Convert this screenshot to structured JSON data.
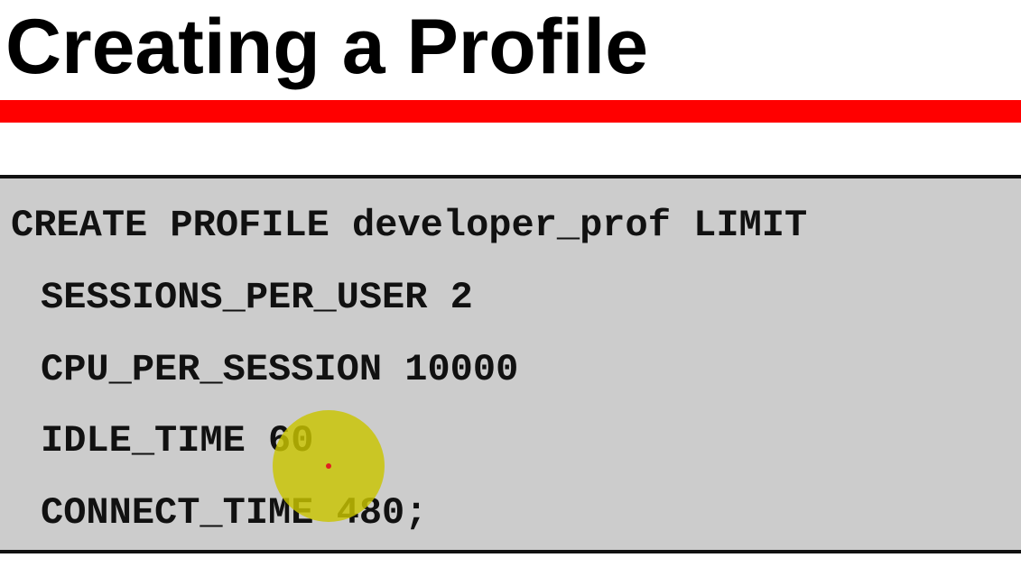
{
  "slide": {
    "title": "Creating a Profile"
  },
  "code": {
    "lines": [
      "CREATE PROFILE developer_prof LIMIT",
      "SESSIONS_PER_USER 2",
      "CPU_PER_SESSION 10000",
      "IDLE_TIME 60",
      "CONNECT_TIME 480;"
    ]
  },
  "colors": {
    "title_rule": "#ff0000",
    "code_background": "#cccccc",
    "cursor_highlight": "#c9c500",
    "cursor_dot": "#e02020"
  }
}
